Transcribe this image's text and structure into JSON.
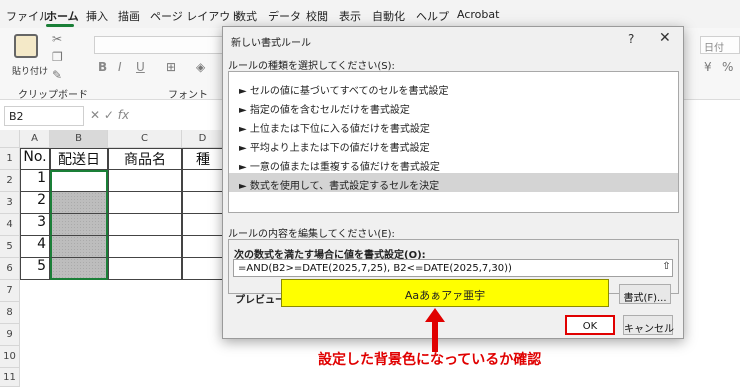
{
  "menu": [
    "ファイル",
    "ホーム",
    "挿入",
    "描画",
    "ページ レイアウト",
    "数式",
    "データ",
    "校閲",
    "表示",
    "自動化",
    "ヘルプ",
    "Acrobat"
  ],
  "ribbon": {
    "paste_label": "貼り付け",
    "clipboard_label": "クリップボード",
    "font_label": "フォント",
    "date_format": "日付",
    "bold": "B",
    "italic": "I",
    "underline": "U",
    "percent": "%"
  },
  "formula_bar": {
    "name_box": "B2",
    "fx": "fx"
  },
  "sheet": {
    "columns": [
      "A",
      "B",
      "C",
      "D"
    ],
    "rows": [
      "1",
      "2",
      "3",
      "4",
      "5",
      "6",
      "7",
      "8",
      "9",
      "10",
      "11"
    ],
    "header_row": [
      "No.",
      "配送日",
      "商品名",
      "種"
    ],
    "numbers": [
      "1",
      "2",
      "3",
      "4",
      "5"
    ]
  },
  "dialog": {
    "title": "新しい書式ルール",
    "help": "?",
    "close": "✕",
    "rule_type_label": "ルールの種類を選択してください(S):",
    "rules": [
      "► セルの値に基づいてすべてのセルを書式設定",
      "► 指定の値を含むセルだけを書式設定",
      "► 上位または下位に入る値だけを書式設定",
      "► 平均より上または下の値だけを書式設定",
      "► 一意の値または重複する値だけを書式設定",
      "► 数式を使用して、書式設定するセルを決定"
    ],
    "edit_label": "ルールの内容を編集してください(E):",
    "formula_label": "次の数式を満たす場合に値を書式設定(O):",
    "formula": "=AND(B2>=DATE(2025,7,25), B2<=DATE(2025,7,30))",
    "preview_label": "プレビュー:",
    "preview_text": "Aaあぁアァ亜宇",
    "format_button": "書式(F)...",
    "ok_button": "OK",
    "cancel_button": "キャンセル"
  },
  "annotation": "設定した背景色になっているか確認",
  "colors": {
    "preview_fill": "#ffff00",
    "highlight": "#e00000",
    "selected_cells": "#bdbdbd"
  }
}
